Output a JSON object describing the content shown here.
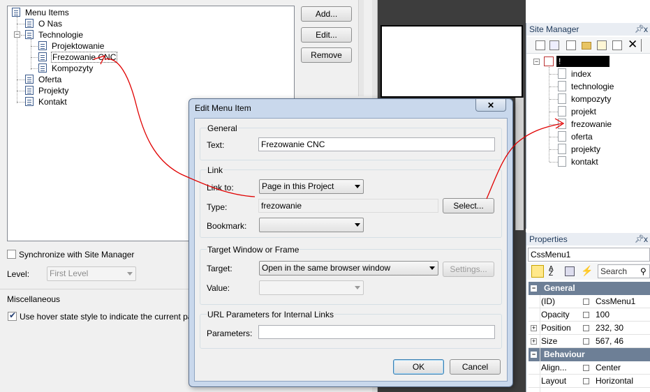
{
  "menu_tree": {
    "root": "Menu Items",
    "items": [
      {
        "label": "O Nas"
      },
      {
        "label": "Technologie"
      },
      {
        "label": "Projektowanie"
      },
      {
        "label": "Frezowanie CNC"
      },
      {
        "label": "Kompozyty"
      },
      {
        "label": "Oferta"
      },
      {
        "label": "Projekty"
      },
      {
        "label": "Kontakt"
      }
    ]
  },
  "menu_buttons": {
    "add": "Add...",
    "edit": "Edit...",
    "remove": "Remove"
  },
  "sync": {
    "label": "Synchronize with Site Manager",
    "checked": false
  },
  "level": {
    "label": "Level:",
    "value": "First Level"
  },
  "misc": {
    "title": "Miscellaneous",
    "hover_label": "Use hover state style to indicate the current page (m",
    "checked": true
  },
  "dialog": {
    "title": "Edit Menu Item",
    "general_title": "General",
    "text_label": "Text:",
    "text_value": "Frezowanie CNC",
    "link_title": "Link",
    "link_to_label": "Link to:",
    "link_to_value": "Page in this Project",
    "type_label": "Type:",
    "type_value": "frezowanie",
    "select_button": "Select...",
    "bookmark_label": "Bookmark:",
    "bookmark_value": "",
    "target_title": "Target Window or Frame",
    "target_label": "Target:",
    "target_value": "Open in the same browser window",
    "settings_button": "Settings...",
    "value_label": "Value:",
    "value_value": "",
    "url_title": "URL Parameters for Internal Links",
    "parameters_label": "Parameters:",
    "parameters_value": "",
    "ok": "OK",
    "cancel": "Cancel",
    "close_glyph": "✕"
  },
  "site_manager": {
    "title": "Site Manager",
    "pin": "ᵽ",
    "close": "x",
    "root_label": "!",
    "pages": [
      "index",
      "technologie",
      "kompozyty",
      "projekt",
      "frezowanie",
      "oferta",
      "projekty",
      "kontakt"
    ]
  },
  "properties": {
    "title": "Properties",
    "object": "CssMenu1",
    "search_placeholder": "Search",
    "categories": [
      {
        "name": "General",
        "rows": [
          {
            "name": "(ID)",
            "value": "CssMenu1"
          },
          {
            "name": "Opacity",
            "value": "100"
          },
          {
            "name": "Position",
            "value": "232, 30"
          },
          {
            "name": "Size",
            "value": "567, 46"
          }
        ]
      },
      {
        "name": "Behaviour",
        "rows": [
          {
            "name": "Align...",
            "value": "Center"
          },
          {
            "name": "Layout",
            "value": "Horizontal"
          }
        ]
      }
    ]
  },
  "colors": {
    "annotation": "#e00000",
    "dialog_frame": "#c9d8ec",
    "category": "#6d7f96"
  }
}
